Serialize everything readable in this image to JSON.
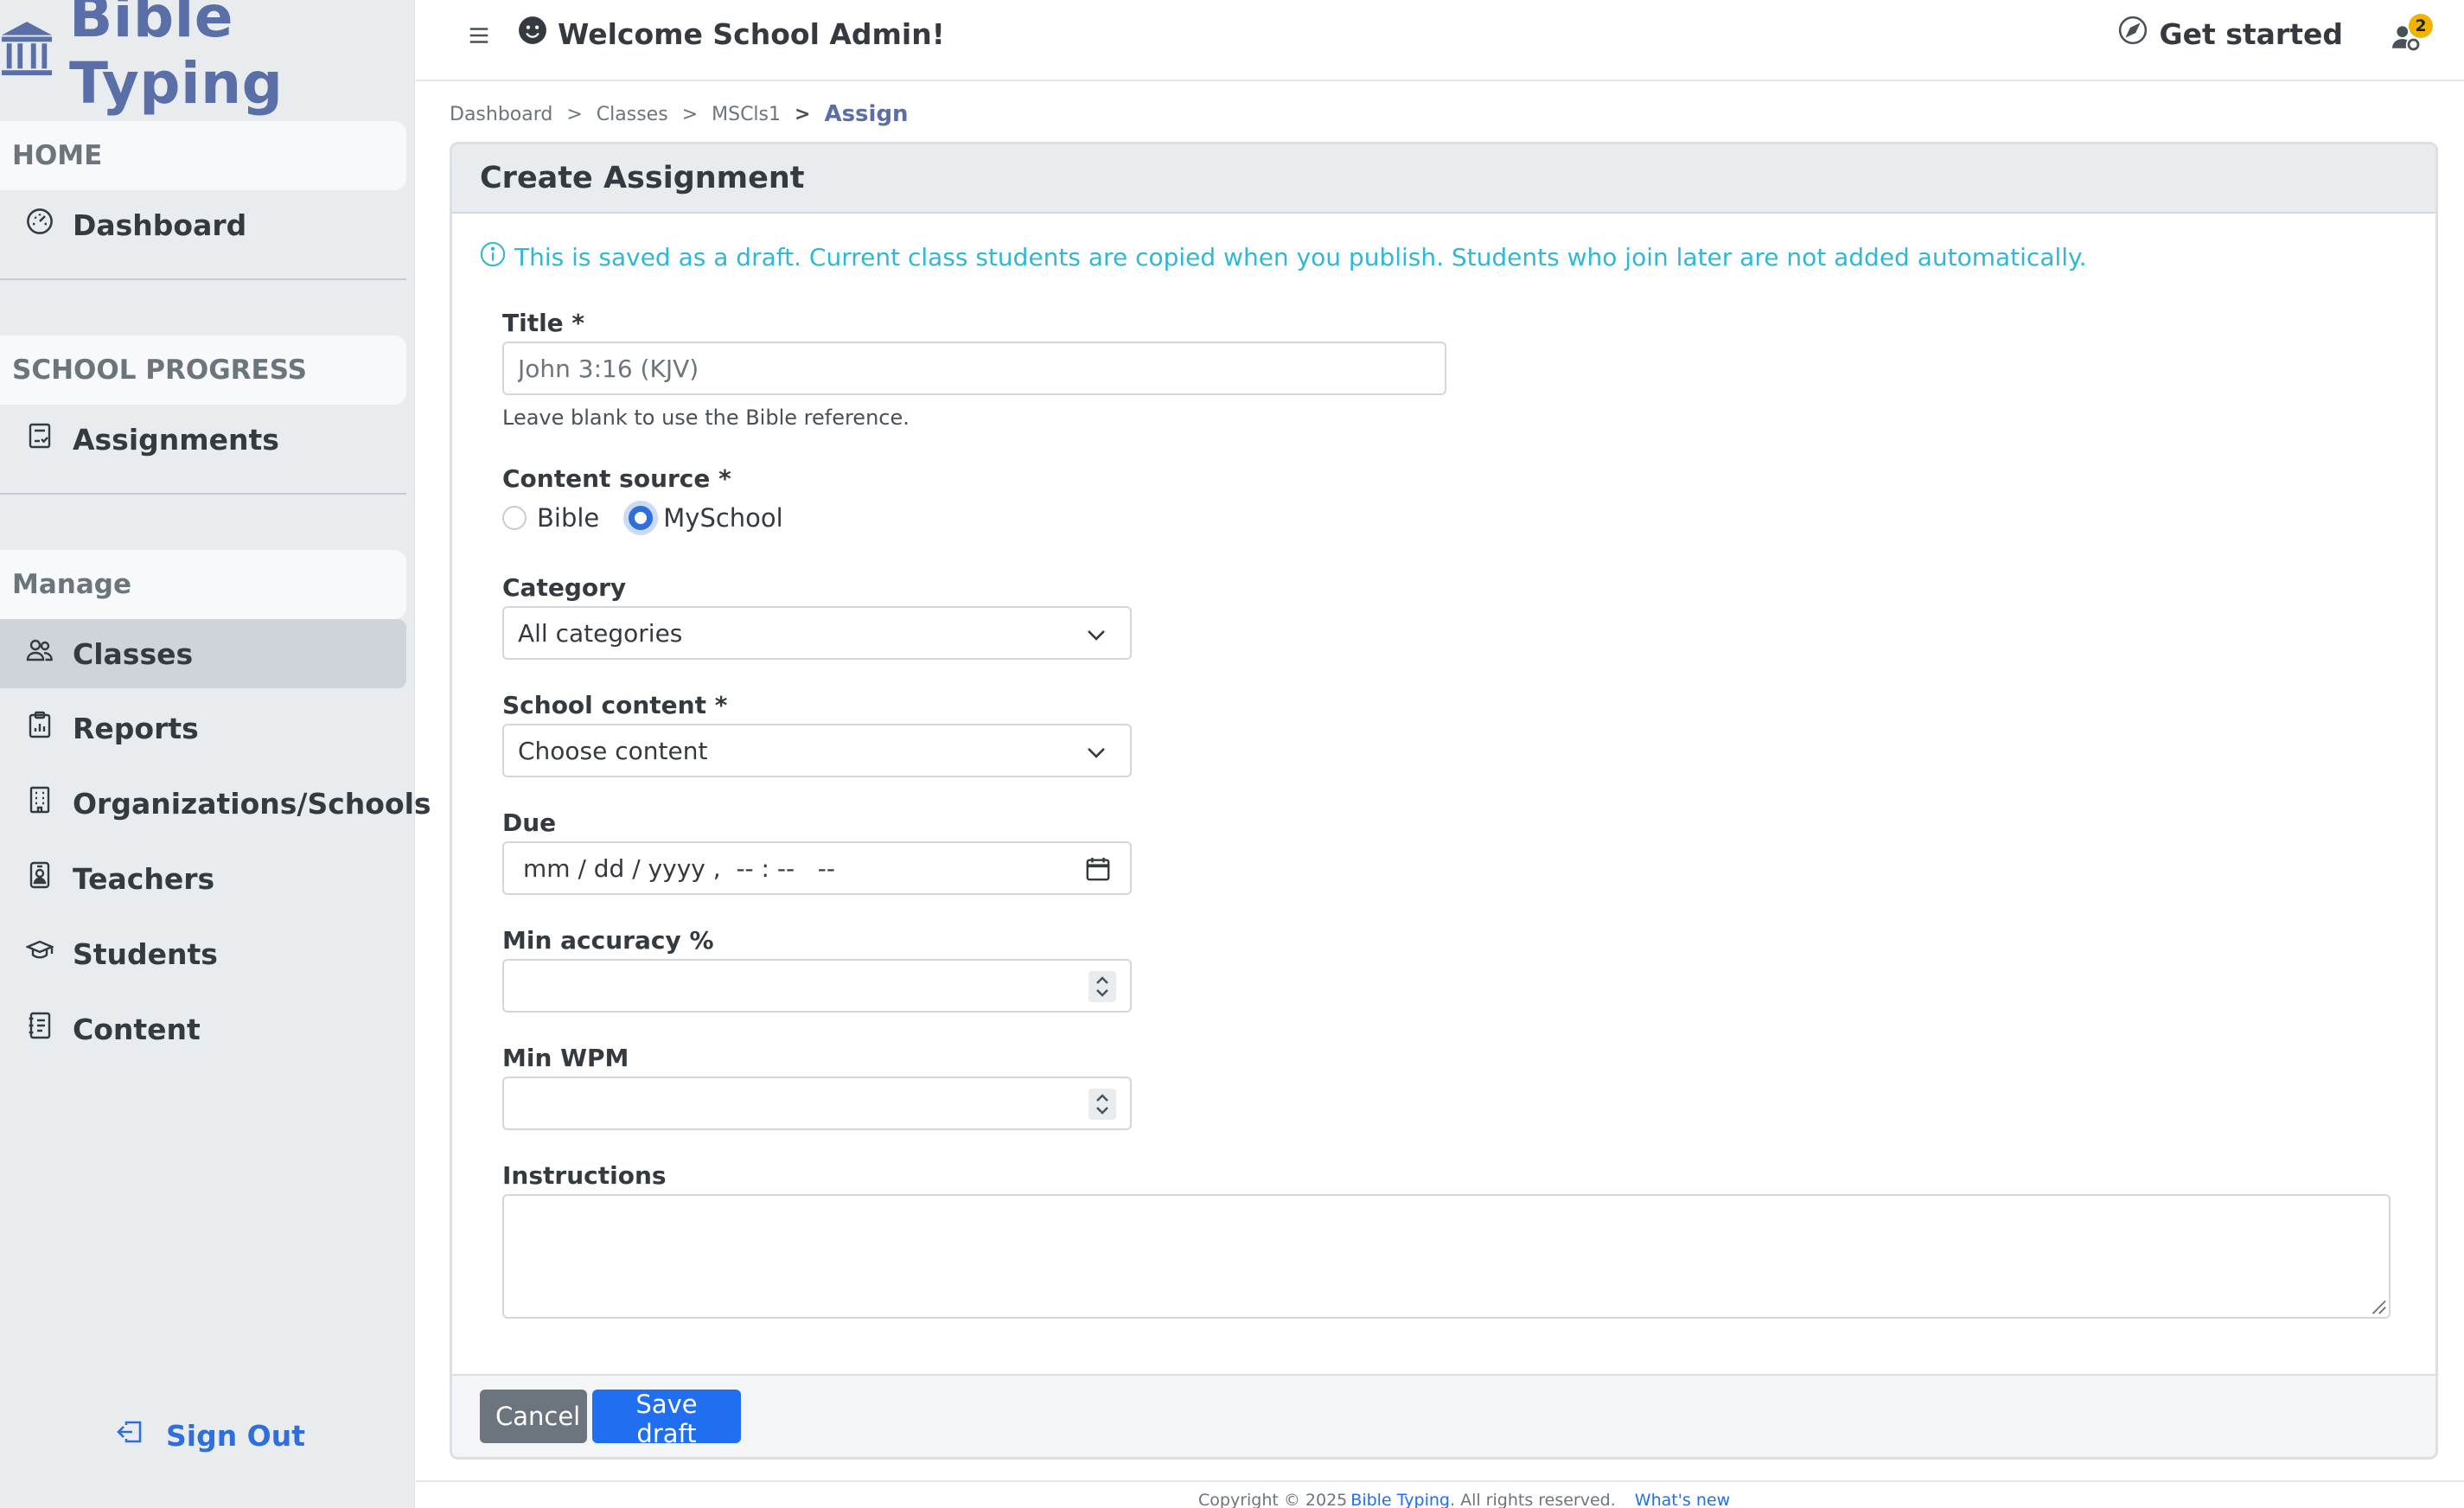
{
  "app": {
    "brand": "Bible Typing",
    "brand_color": "#5a6fa8",
    "accent_color": "#1f6ff0",
    "info_color": "#2fb8d6"
  },
  "sidebar": {
    "sections": [
      {
        "title": "HOME",
        "items": [
          {
            "label": "Dashboard",
            "icon": "dashboard-gauge-icon"
          }
        ]
      },
      {
        "title": "SCHOOL PROGRESS",
        "items": [
          {
            "label": "Assignments",
            "icon": "assignments-checklist-icon"
          }
        ]
      },
      {
        "title": "Manage",
        "items": [
          {
            "label": "Classes",
            "icon": "people-icon",
            "active": true
          },
          {
            "label": "Reports",
            "icon": "reports-clipboard-icon"
          },
          {
            "label": "Organizations/Schools",
            "icon": "building-icon"
          },
          {
            "label": "Teachers",
            "icon": "teacher-badge-icon"
          },
          {
            "label": "Students",
            "icon": "graduation-cap-icon"
          },
          {
            "label": "Content",
            "icon": "journal-text-icon"
          }
        ]
      }
    ],
    "sign_out": "Sign Out"
  },
  "topbar": {
    "welcome": "Welcome School Admin!",
    "get_started": "Get started",
    "notification_count": "2"
  },
  "breadcrumb": {
    "items": [
      "Dashboard",
      "Classes",
      "MSCls1"
    ],
    "separators": [
      ">",
      ">",
      ">"
    ],
    "current": "Assign"
  },
  "form": {
    "heading": "Create Assignment",
    "info_text": "This is saved as a draft. Current class students are copied when you publish. Students who join later are not added automatically.",
    "title_label": "Title *",
    "title_placeholder": "John 3:16 (KJV)",
    "title_help": "Leave blank to use the Bible reference.",
    "content_source_label": "Content source *",
    "content_source_options": [
      "Bible",
      "MySchool"
    ],
    "content_source_selected": "MySchool",
    "category_label": "Category",
    "category_value": "All categories",
    "school_content_label": "School content *",
    "school_content_value": "Choose content",
    "due_label": "Due",
    "due_placeholder": "mm / dd / yyyy ,  -- : --   --",
    "min_accuracy_label": "Min accuracy %",
    "min_accuracy_value": "",
    "min_wpm_label": "Min WPM",
    "min_wpm_value": "",
    "instructions_label": "Instructions",
    "instructions_value": "",
    "cancel_label": "Cancel",
    "save_label": "Save draft"
  },
  "footer": {
    "copyright": "Copyright © 2025",
    "brand_link": "Bible Typing",
    "rights": ". All rights reserved.",
    "whats_new": "What's new"
  }
}
